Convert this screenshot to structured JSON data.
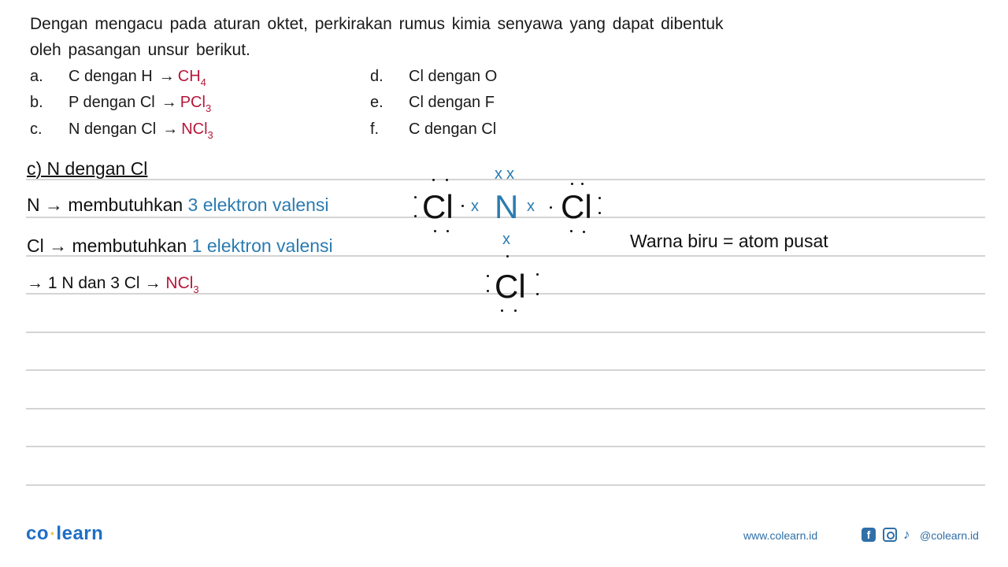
{
  "question": {
    "text": "Dengan mengacu pada aturan oktet, perkirakan rumus kimia senyawa yang dapat dibentuk oleh pasangan unsur berikut.",
    "items": [
      {
        "label": "a.",
        "text": "C dengan H",
        "arrow": "→",
        "answer_base": "CH",
        "answer_sub": "4"
      },
      {
        "label": "b.",
        "text": "P dengan Cl",
        "arrow": "→",
        "answer_base": "PCl",
        "answer_sub": "3"
      },
      {
        "label": "c.",
        "text": "N dengan Cl",
        "arrow": "→",
        "answer_base": "NCl",
        "answer_sub": "3"
      },
      {
        "label": "d.",
        "text": "Cl dengan O"
      },
      {
        "label": "e.",
        "text": "Cl dengan F"
      },
      {
        "label": "f.",
        "text": "C dengan Cl"
      }
    ]
  },
  "solution": {
    "heading": "c) N dengan Cl",
    "line1": {
      "prefix": "N",
      "arrow": "→",
      "text": "membutuhkan",
      "highlight": "3 elektron valensi"
    },
    "line2": {
      "prefix": "Cl",
      "arrow": "→",
      "text": "membutuhkan",
      "highlight": "1 elektron valensi"
    },
    "line3": {
      "arrow1": "→",
      "text": "1 N dan 3 Cl",
      "arrow2": "→",
      "answer_base": "NCl",
      "answer_sub": "3"
    },
    "note": "Warna biru = atom pusat",
    "lewis": {
      "center_atom": "N",
      "outer_atoms": [
        "Cl",
        "Cl",
        "Cl"
      ],
      "center_electron_mark": "x",
      "outer_electron_mark": "•"
    }
  },
  "colors": {
    "answer": "#b5173a",
    "highlight": "#2b7bb0",
    "brand": "#1f6fc5"
  },
  "footer": {
    "logo_left": "co",
    "logo_sep": "•",
    "logo_right": "learn",
    "website": "www.colearn.id",
    "social_icons": [
      "facebook-icon",
      "instagram-icon",
      "tiktok-icon"
    ],
    "handle": "@colearn.id",
    "fb_glyph": "f",
    "tt_glyph": "♪"
  }
}
